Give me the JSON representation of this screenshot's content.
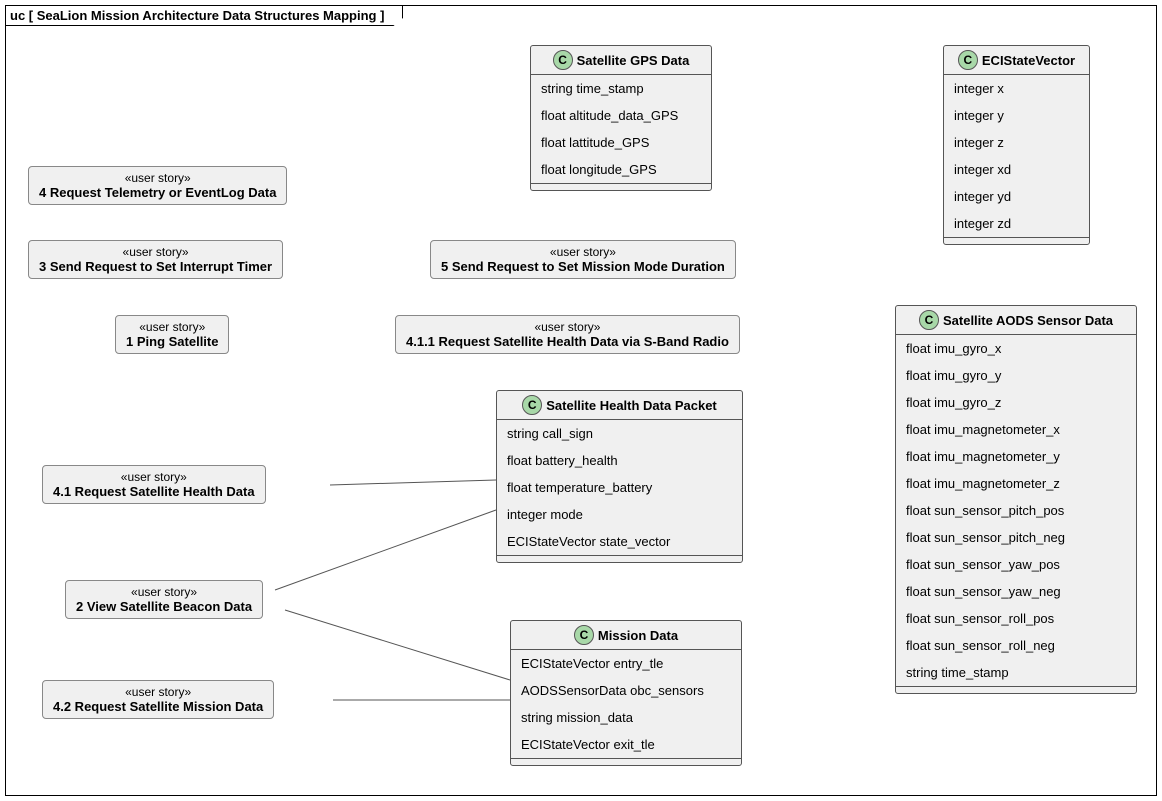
{
  "frame_title": "uc [ SeaLion Mission Architecture Data Structures Mapping ]",
  "stories": {
    "s4": {
      "stereo": "«user story»",
      "title": "4 Request Telemetry or EventLog Data"
    },
    "s3": {
      "stereo": "«user story»",
      "title": "3 Send Request to Set Interrupt Timer"
    },
    "s5": {
      "stereo": "«user story»",
      "title": "5 Send Request to Set Mission Mode Duration"
    },
    "s1": {
      "stereo": "«user story»",
      "title": "1 Ping Satellite"
    },
    "s411": {
      "stereo": "«user story»",
      "title": "4.1.1 Request Satellite Health Data via S-Band Radio"
    },
    "s41": {
      "stereo": "«user story»",
      "title": "4.1 Request Satellite Health Data"
    },
    "s2": {
      "stereo": "«user story»",
      "title": "2 View Satellite Beacon Data"
    },
    "s42": {
      "stereo": "«user story»",
      "title": "4.2 Request Satellite Mission Data"
    }
  },
  "classes": {
    "gps": {
      "name": "Satellite GPS Data",
      "attrs": [
        "string time_stamp",
        "float altitude_data_GPS",
        "float lattitude_GPS",
        "float longitude_GPS"
      ]
    },
    "eci": {
      "name": "ECIStateVector",
      "attrs": [
        "integer x",
        "integer y",
        "integer z",
        "integer xd",
        "integer yd",
        "integer zd"
      ]
    },
    "health": {
      "name": "Satellite Health Data Packet",
      "attrs": [
        "string call_sign",
        "float battery_health",
        "float temperature_battery",
        "integer mode",
        "ECIStateVector state_vector"
      ]
    },
    "aods": {
      "name": "Satellite AODS Sensor Data",
      "attrs": [
        "float imu_gyro_x",
        "float imu_gyro_y",
        "float imu_gyro_z",
        "float imu_magnetometer_x",
        "float imu_magnetometer_y",
        "float imu_magnetometer_z",
        "float sun_sensor_pitch_pos",
        "float sun_sensor_pitch_neg",
        "float sun_sensor_yaw_pos",
        "float sun_sensor_yaw_neg",
        "float sun_sensor_roll_pos",
        "float sun_sensor_roll_neg",
        "string time_stamp"
      ]
    },
    "mission": {
      "name": "Mission Data",
      "attrs": [
        "ECIStateVector entry_tle",
        "AODSSensorData obc_sensors",
        "string mission_data",
        "ECIStateVector exit_tle"
      ]
    }
  },
  "c_letter": "C"
}
